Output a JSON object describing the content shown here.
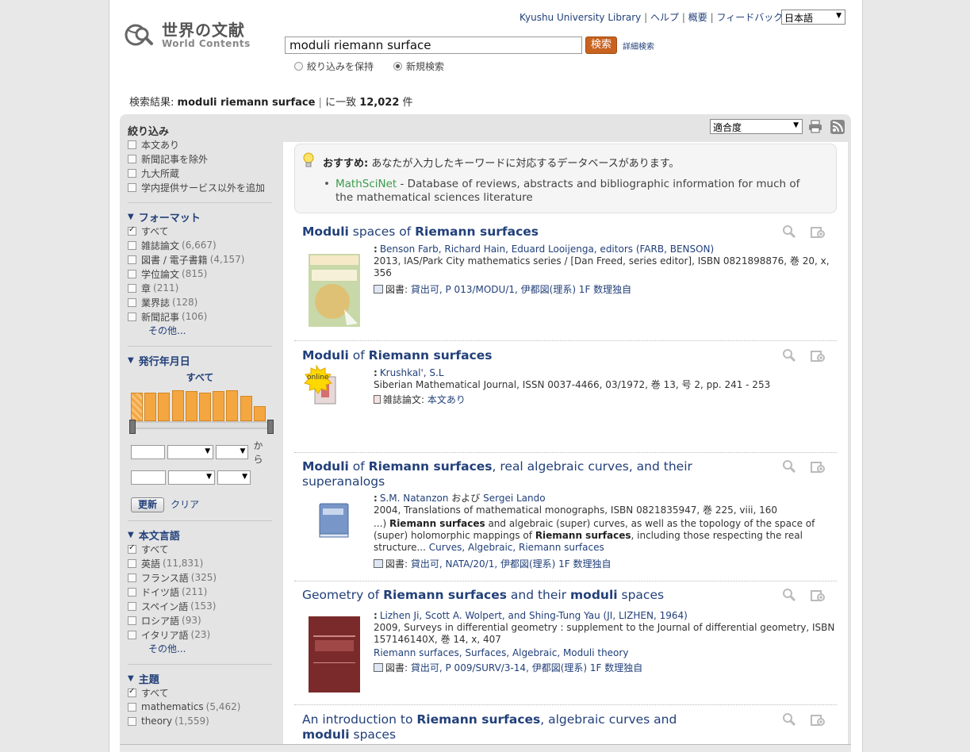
{
  "logo": {
    "jp": "世界の文献",
    "en": "World Contents"
  },
  "toplinks": {
    "library": "Kyushu University Library",
    "help": "ヘルプ",
    "overview": "概要",
    "feedback": "フィードバック",
    "sep": "|",
    "language": "日本語"
  },
  "search": {
    "query": "moduli riemann surface",
    "button": "検索",
    "advanced": "詳細検索",
    "keep_refine": "絞り込みを保持",
    "new_search": "新規検索"
  },
  "summary": {
    "prefix": "検索結果:",
    "query": "moduli riemann surface",
    "mid": "に一致",
    "count": "12,022",
    "suffix": "件"
  },
  "sort": {
    "selected": "適合度"
  },
  "sidebar": {
    "refine_title": "絞り込み",
    "refine_items": [
      {
        "label": "本文あり",
        "checked": false
      },
      {
        "label": "新聞記事を除外",
        "checked": false
      },
      {
        "label": "九大所蔵",
        "checked": false
      },
      {
        "label": "学内提供サービス以外を追加",
        "checked": false
      }
    ],
    "format": {
      "title": "フォーマット",
      "items": [
        {
          "label": "すべて",
          "count": "",
          "checked": true
        },
        {
          "label": "雑誌論文",
          "count": "(6,667)",
          "checked": false
        },
        {
          "label": "図書 / 電子書籍",
          "count": "(4,157)",
          "checked": false
        },
        {
          "label": "学位論文",
          "count": "(815)",
          "checked": false
        },
        {
          "label": "章",
          "count": "(211)",
          "checked": false
        },
        {
          "label": "業界誌",
          "count": "(128)",
          "checked": false
        },
        {
          "label": "新聞記事",
          "count": "(106)",
          "checked": false
        }
      ],
      "more": "その他..."
    },
    "date": {
      "title": "発行年月日",
      "range_label": "すべて",
      "bars": [
        0.82,
        0.82,
        0.82,
        0.88,
        0.86,
        0.82,
        0.86,
        0.88,
        0.72,
        0.44
      ],
      "to_label": "から",
      "update": "更新",
      "clear": "クリア"
    },
    "language": {
      "title": "本文言語",
      "items": [
        {
          "label": "すべて",
          "count": "",
          "checked": true
        },
        {
          "label": "英語",
          "count": "(11,831)",
          "checked": false
        },
        {
          "label": "フランス語",
          "count": "(325)",
          "checked": false
        },
        {
          "label": "ドイツ語",
          "count": "(211)",
          "checked": false
        },
        {
          "label": "スペイン語",
          "count": "(153)",
          "checked": false
        },
        {
          "label": "ロシア語",
          "count": "(93)",
          "checked": false
        },
        {
          "label": "イタリア語",
          "count": "(23)",
          "checked": false
        }
      ],
      "more": "その他..."
    },
    "subject": {
      "title": "主題",
      "items": [
        {
          "label": "すべて",
          "count": "",
          "checked": true
        },
        {
          "label": "mathematics",
          "count": "(5,462)",
          "checked": false
        },
        {
          "label": "theory",
          "count": "(1,559)",
          "checked": false
        }
      ]
    }
  },
  "recommendation": {
    "label": "おすすめ:",
    "text": "あなたが入力したキーワードに対応するデータベースがあります。",
    "db_name": "MathSciNet",
    "db_desc": " - Database of reviews, abstracts and bibliographic information for much of the mathematical sciences literature"
  },
  "results": [
    {
      "title_parts": [
        {
          "t": "Moduli",
          "b": true
        },
        {
          "t": " spaces of ",
          "b": false
        },
        {
          "t": "Riemann surfaces",
          "b": true
        }
      ],
      "authors": "Benson Farb, Richard Hain, Eduard Looijenga, editors (FARB, BENSON)",
      "pub": "2013, IAS/Park City mathematics series / [Dan Freed, series editor], ISBN 0821898876, 巻 20, x, 356",
      "format": "図書:",
      "availability": "貸出可, P 013/MODU/1, 伊都図(理系) 1F 数理独自"
    },
    {
      "title_parts": [
        {
          "t": "Moduli",
          "b": true
        },
        {
          "t": " of ",
          "b": false
        },
        {
          "t": "Riemann surfaces",
          "b": true
        }
      ],
      "authors": "Krushkal', S.L",
      "pub": "Siberian Mathematical Journal, ISSN 0037-4466, 03/1972, 巻 13, 号 2, pp. 241 - 253",
      "format": "雑誌論文:",
      "availability": "本文あり",
      "online": "online"
    },
    {
      "title_parts": [
        {
          "t": "Moduli",
          "b": true
        },
        {
          "t": " of ",
          "b": false
        },
        {
          "t": "Riemann surfaces",
          "b": true
        },
        {
          "t": ", real algebraic curves, and their superanalogs",
          "b": false
        }
      ],
      "author1": "S.M. Natanzon",
      "author_and": " および ",
      "author2": "Sergei Lando",
      "pub": "2004, Translations of mathematical monographs, ISBN 082183594​7, 巻 225, viii, 160",
      "snippet_parts": [
        {
          "t": "...) ",
          "b": false
        },
        {
          "t": "Riemann surfaces",
          "b": true
        },
        {
          "t": " and algebraic (super) curves, as well as the topology of the space of (super) holomorphic mappings of ",
          "b": false
        },
        {
          "t": "Riemann surfaces",
          "b": true
        },
        {
          "t": ", including those respecting the real structure... ",
          "b": false
        }
      ],
      "subjects": "Curves, Algebraic, Riemann surfaces",
      "format": "図書:",
      "availability": "貸出可, NATA/20/1, 伊都図(理系) 1F 数理独自"
    },
    {
      "title_parts": [
        {
          "t": "Geometry of ",
          "b": false
        },
        {
          "t": "Riemann surfaces",
          "b": true
        },
        {
          "t": " and their ",
          "b": false
        },
        {
          "t": "moduli",
          "b": true
        },
        {
          "t": " spaces",
          "b": false
        }
      ],
      "authors": "Lizhen Ji, Scott A. Wolpert, and Shing-Tung Yau (JI, LIZHEN, 1964)",
      "pub": "2009, Surveys in differential geometry : supplement to the Journal of differential geometry, ISBN 157146140X, 巻 14, x, 407",
      "subjects": "Riemann surfaces, Surfaces, Algebraic, Moduli theory",
      "format": "図書:",
      "availability": "貸出可, P 009/SURV/3-14, 伊都図(理系) 1F 数理独自"
    },
    {
      "title_parts": [
        {
          "t": "An introduction to ",
          "b": false
        },
        {
          "t": "Riemann surfaces",
          "b": true
        },
        {
          "t": ", algebraic curves and ",
          "b": false
        },
        {
          "t": "moduli",
          "b": true
        },
        {
          "t": " spaces",
          "b": false
        }
      ]
    }
  ],
  "colors": {
    "link": "#22407a",
    "accent": "#c8621f",
    "green_link": "#3c9b4c",
    "bar": "#f4a640"
  }
}
